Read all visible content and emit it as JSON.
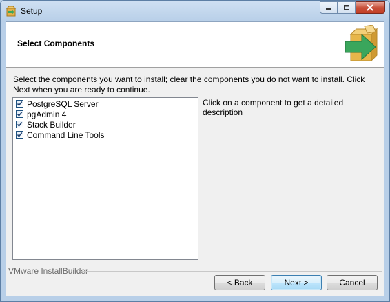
{
  "window": {
    "title": "Setup"
  },
  "header": {
    "title": "Select Components"
  },
  "intro": "Select the components you want to install; clear the components you do not want to install. Click Next when you are ready to continue.",
  "components": [
    {
      "label": "PostgreSQL Server",
      "checked": true
    },
    {
      "label": "pgAdmin 4",
      "checked": true
    },
    {
      "label": "Stack Builder",
      "checked": true
    },
    {
      "label": "Command Line Tools",
      "checked": true
    }
  ],
  "description": "Click on a component to get a detailed description",
  "brand": "VMware InstallBuilder",
  "buttons": {
    "back": "< Back",
    "next": "Next >",
    "cancel": "Cancel"
  },
  "icons": {
    "app": "installer-box-icon",
    "logo": "box-arrow-icon",
    "check": "checkmark-icon"
  },
  "colors": {
    "accent_green": "#3aa65c",
    "box": "#e7b64a"
  }
}
